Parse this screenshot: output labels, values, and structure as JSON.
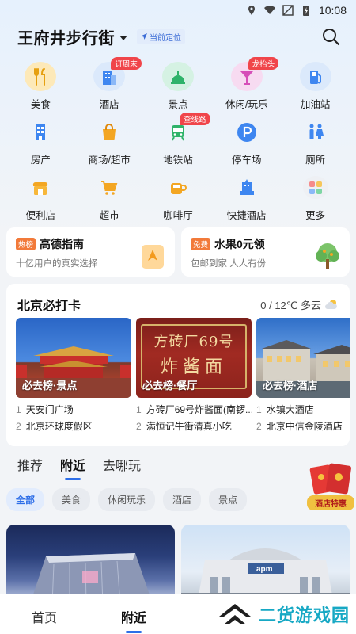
{
  "status_bar": {
    "time": "10:08"
  },
  "header": {
    "location_title": "王府井步行街",
    "current_location_tag": "当前定位"
  },
  "categories": [
    {
      "label": "美食",
      "icon": "fork-knife-icon",
      "badge": ""
    },
    {
      "label": "酒店",
      "icon": "hotel-building-icon",
      "badge": "订周末"
    },
    {
      "label": "景点",
      "icon": "scenic-spot-icon",
      "badge": ""
    },
    {
      "label": "休闲/玩乐",
      "icon": "cocktail-icon",
      "badge": "龙抬头"
    },
    {
      "label": "加油站",
      "icon": "gas-station-icon",
      "badge": ""
    },
    {
      "label": "房产",
      "icon": "building-icon",
      "badge": ""
    },
    {
      "label": "商场/超市",
      "icon": "shopping-bag-icon",
      "badge": ""
    },
    {
      "label": "地铁站",
      "icon": "subway-icon",
      "badge": "查线路"
    },
    {
      "label": "停车场",
      "icon": "parking-icon",
      "badge": ""
    },
    {
      "label": "厕所",
      "icon": "restroom-icon",
      "badge": ""
    },
    {
      "label": "便利店",
      "icon": "store-icon",
      "badge": ""
    },
    {
      "label": "超市",
      "icon": "cart-icon",
      "badge": ""
    },
    {
      "label": "咖啡厅",
      "icon": "coffee-icon",
      "badge": ""
    },
    {
      "label": "快捷酒店",
      "icon": "quick-hotel-icon",
      "badge": ""
    },
    {
      "label": "更多",
      "icon": "more-grid-icon",
      "badge": ""
    }
  ],
  "promos": [
    {
      "tag": "热榜",
      "title": "高德指南",
      "subtitle": "十亿用户的真实选择"
    },
    {
      "tag": "免费",
      "title": "水果0元领",
      "subtitle": "包邮到家 人人有份"
    }
  ],
  "checkin": {
    "title": "北京必打卡",
    "weather": "0 / 12℃ 多云",
    "columns": [
      {
        "image_label": "必去榜·景点",
        "items": [
          "天安门广场",
          "北京环球度假区"
        ]
      },
      {
        "image_label": "必去榜·餐厅",
        "items": [
          "方砖厂69号炸酱面(南锣...",
          "满恒记牛街清真小吃"
        ]
      },
      {
        "image_label": "必去榜·酒店",
        "items": [
          "水镇大酒店",
          "北京中信金陵酒店"
        ]
      }
    ],
    "restaurant_sign": "方砖厂69号",
    "restaurant_sign2": "炸酱面"
  },
  "feed_tabs": [
    "推荐",
    "附近",
    "去哪玩"
  ],
  "feed_active_tab": "附近",
  "chips": [
    "全部",
    "美食",
    "休闲玩乐",
    "酒店",
    "景点"
  ],
  "red_packet_label": "酒店特惠",
  "bottom_nav": {
    "home": "首页",
    "nearby": "附近"
  },
  "watermark": "二货游戏园",
  "colors": {
    "accent": "#2d6ee8",
    "badge_red": "#f0454a",
    "tag_orange": "#f27a3a"
  }
}
